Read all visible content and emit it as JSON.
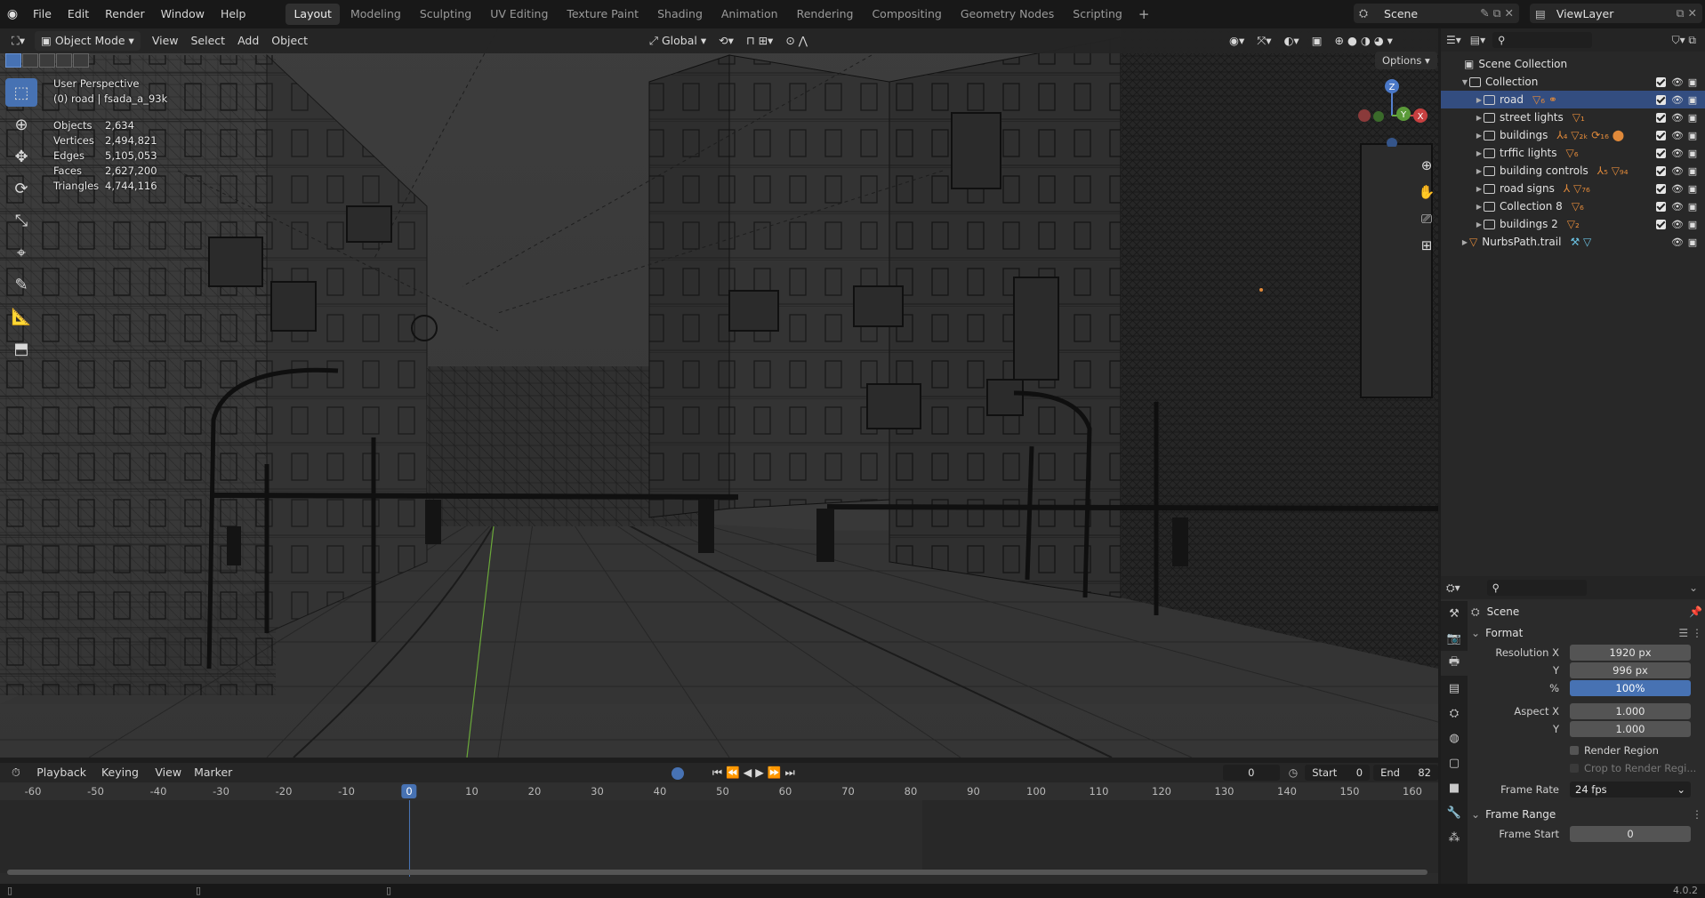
{
  "topbar": {
    "menus": [
      "File",
      "Edit",
      "Render",
      "Window",
      "Help"
    ],
    "workspaces": [
      "Layout",
      "Modeling",
      "Sculpting",
      "UV Editing",
      "Texture Paint",
      "Shading",
      "Animation",
      "Rendering",
      "Compositing",
      "Geometry Nodes",
      "Scripting"
    ],
    "active_workspace": "Layout",
    "scene_name": "Scene",
    "view_layer": "ViewLayer"
  },
  "viewport_header": {
    "mode": "Object Mode",
    "menus": [
      "View",
      "Select",
      "Add",
      "Object"
    ],
    "transform_orientation": "Global",
    "options_label": "Options"
  },
  "viewport_overlay": {
    "view_name": "User Perspective",
    "active_object": "(0) road | fsada_a_93k",
    "stats": [
      {
        "label": "Objects",
        "value": "2,634"
      },
      {
        "label": "Vertices",
        "value": "2,494,821"
      },
      {
        "label": "Edges",
        "value": "5,105,053"
      },
      {
        "label": "Faces",
        "value": "2,627,200"
      },
      {
        "label": "Triangles",
        "value": "4,744,116"
      }
    ]
  },
  "gizmo": {
    "x": "X",
    "y": "Y",
    "z": "Z"
  },
  "timeline": {
    "menus": [
      "Playback",
      "Keying",
      "View",
      "Marker"
    ],
    "current_frame": "0",
    "start_label": "Start",
    "start": "0",
    "end_label": "End",
    "end": "82",
    "ticks": [
      "-60",
      "-50",
      "-40",
      "-30",
      "-20",
      "-10",
      "0",
      "10",
      "20",
      "30",
      "40",
      "50",
      "60",
      "70",
      "80",
      "90",
      "100",
      "110",
      "120",
      "130",
      "140",
      "150",
      "160"
    ],
    "playhead_frame": "0"
  },
  "outliner": {
    "root": "Scene Collection",
    "collection": "Collection",
    "items": [
      {
        "name": "road",
        "mods": "▽₆ ⚭",
        "selected": true
      },
      {
        "name": "street lights",
        "mods": "▽₁"
      },
      {
        "name": "buildings",
        "mods": "⅄₄ ▽₂ₖ ⟳₁₆ ⬤"
      },
      {
        "name": "trffic lights",
        "mods": "▽₆"
      },
      {
        "name": "building controls",
        "mods": "⅄₅ ▽₉₄"
      },
      {
        "name": "road signs",
        "mods": "⅄ ▽₇₆"
      },
      {
        "name": "Collection 8",
        "mods": "▽₆"
      },
      {
        "name": "buildings 2",
        "mods": "▽₂"
      }
    ],
    "extra": {
      "name": "NurbsPath.trail"
    }
  },
  "properties": {
    "context": "Scene",
    "format_panel": "Format",
    "resolution_x_label": "Resolution X",
    "resolution_x": "1920 px",
    "resolution_y_label": "Y",
    "resolution_y": "996 px",
    "percent_label": "%",
    "percent": "100%",
    "aspect_x_label": "Aspect X",
    "aspect_x": "1.000",
    "aspect_y_label": "Y",
    "aspect_y": "1.000",
    "render_region": "Render Region",
    "crop_region": "Crop to Render Regi...",
    "frame_rate_label": "Frame Rate",
    "frame_rate": "24 fps",
    "frame_range_panel": "Frame Range",
    "frame_start_label": "Frame Start",
    "frame_start": "0"
  },
  "status_bar": {
    "version": "4.0.2"
  },
  "colors": {
    "accent": "#4772b3",
    "selected_row": "#334d80",
    "modifier": "#e0893a"
  }
}
